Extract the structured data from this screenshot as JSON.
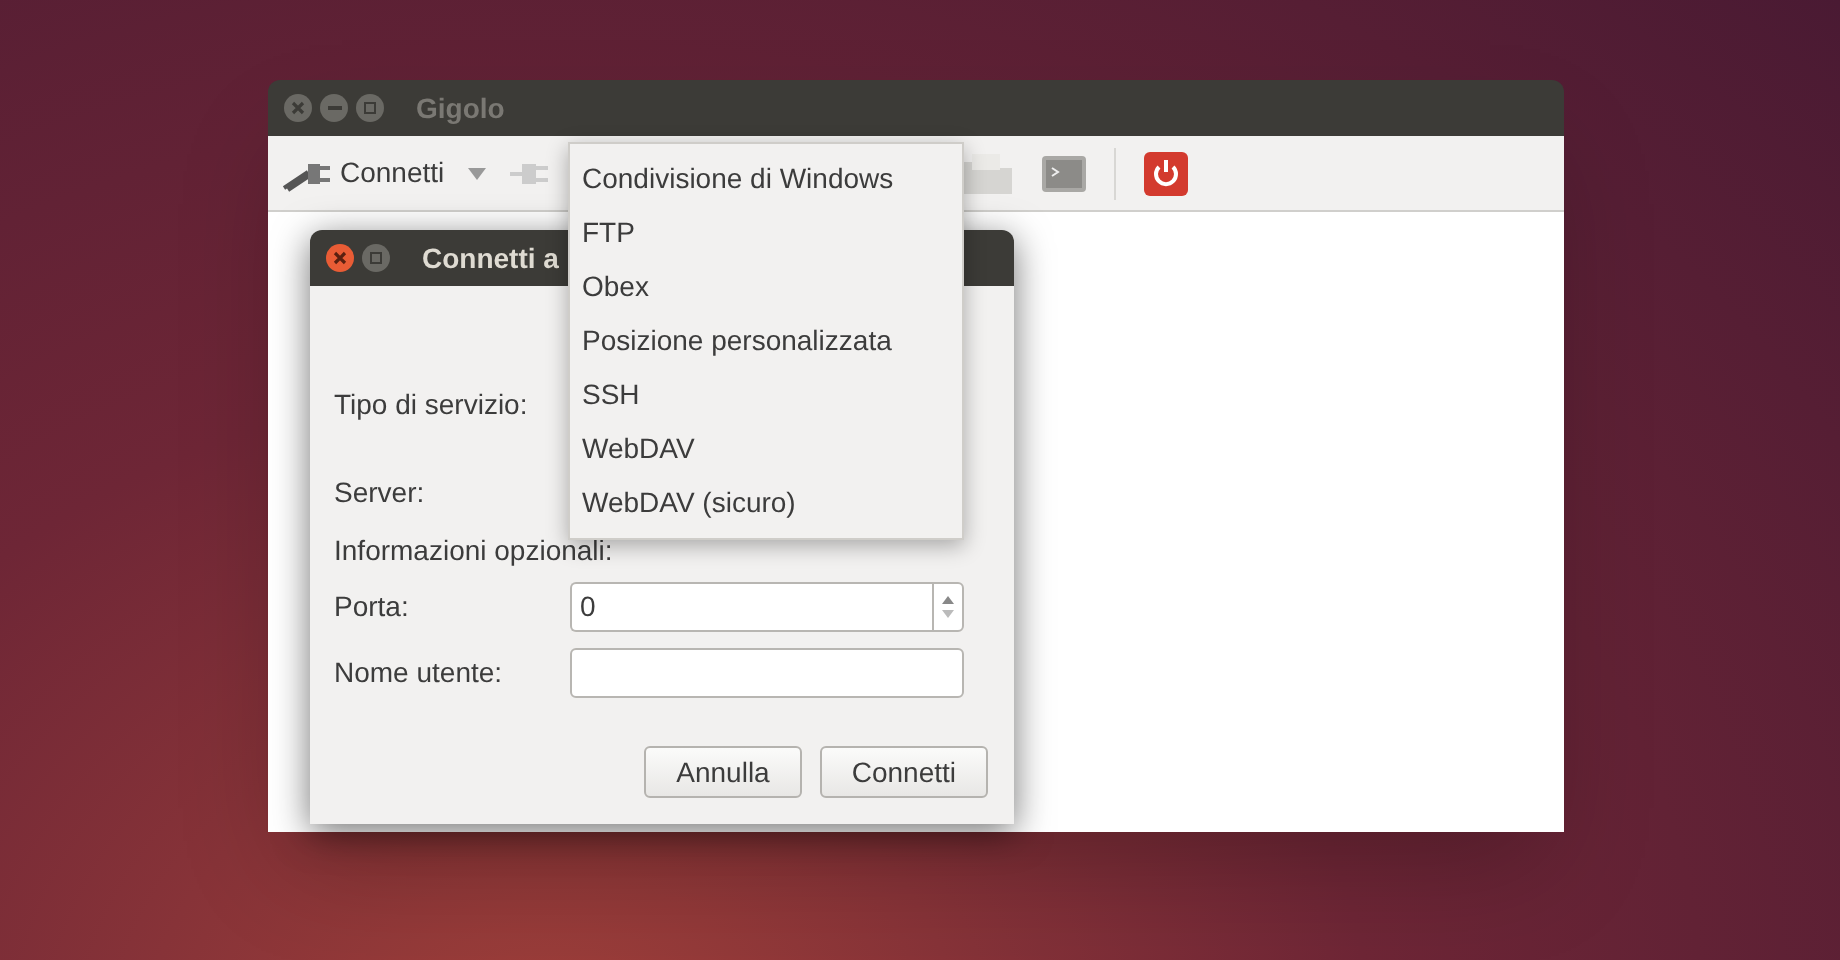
{
  "window": {
    "title": "Gigolo"
  },
  "toolbar": {
    "connect_button": "Connetti"
  },
  "dialog": {
    "title": "Connetti a",
    "rows": [
      {
        "kind": "covered",
        "label": "Tipo di servizio:"
      },
      {
        "kind": "covered",
        "label": "Server:"
      },
      {
        "kind": "heading",
        "label": "Informazioni opzionali:"
      },
      {
        "kind": "spin",
        "label": "Porta:",
        "value": "0"
      },
      {
        "kind": "text",
        "label": "Nome utente:"
      }
    ],
    "buttons": [
      "Annulla",
      "Connetti"
    ]
  },
  "menu": {
    "items": [
      "Condivisione di Windows",
      "FTP",
      "Obex",
      "Posizione personalizzata",
      "SSH",
      "WebDAV",
      "WebDAV (sicuro)"
    ]
  }
}
